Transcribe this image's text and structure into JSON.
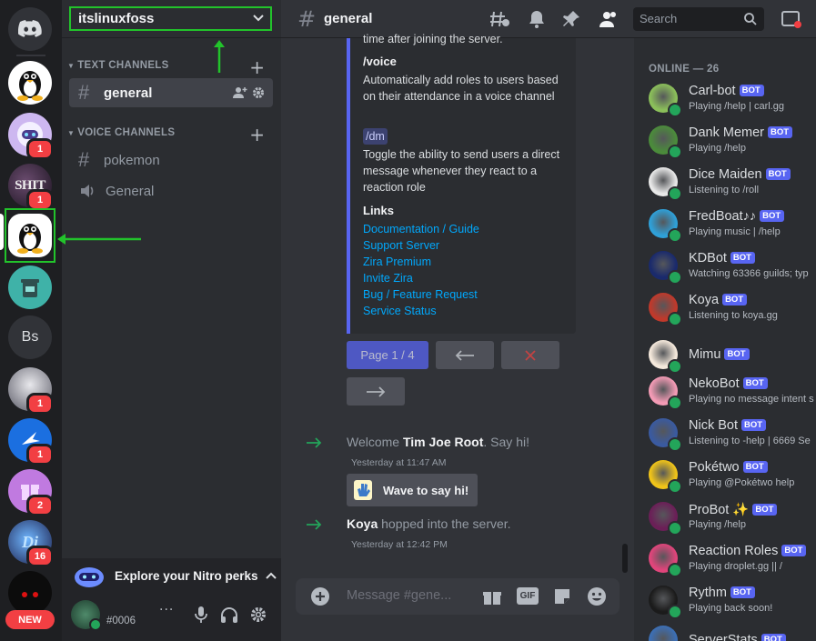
{
  "server": {
    "name": "itslinuxfoss"
  },
  "rail": {
    "servers": [
      {
        "label": "",
        "badge": ""
      },
      {
        "label": "",
        "badge": "1"
      },
      {
        "label": "SHIT",
        "badge": "1"
      },
      {
        "label": "",
        "badge": ""
      },
      {
        "label": "",
        "badge": ""
      },
      {
        "label": "Bs",
        "badge": ""
      },
      {
        "label": "",
        "badge": "1"
      },
      {
        "label": "",
        "badge": "1"
      },
      {
        "label": "",
        "badge": "2"
      },
      {
        "label": "",
        "badge": "16"
      },
      {
        "label": "",
        "badge": ""
      }
    ],
    "new_label": "NEW"
  },
  "sidebar": {
    "text_category": "TEXT CHANNELS",
    "voice_category": "VOICE CHANNELS",
    "text_channels": [
      {
        "name": "general"
      }
    ],
    "voice_channels": [
      {
        "name": "pokemon",
        "icon": "hash"
      },
      {
        "name": "General",
        "icon": "speaker"
      }
    ],
    "nitro": "Explore your Nitro perks",
    "user_tag": "#0006"
  },
  "topbar": {
    "channel": "general",
    "search_placeholder": "Search"
  },
  "embed": {
    "cut_line": "time after joining the server.",
    "voice_cmd": "/voice",
    "voice_desc": "Automatically add roles to users based on their attendance in a voice channel",
    "dm_cmd": "/dm",
    "dm_desc": "Toggle the ability to send users a direct message whenever they react to a reaction role",
    "links_title": "Links",
    "links": [
      "Documentation / Guide",
      "Support Server",
      "Zira Premium",
      "Invite Zira",
      "Bug / Feature Request",
      "Service Status"
    ]
  },
  "pager": {
    "page": "Page 1 / 4"
  },
  "messages": [
    {
      "pre": "Welcome ",
      "name": "Tim Joe Root",
      "post": ". Say hi!",
      "time": "Yesterday at 11:47 AM",
      "wave": "Wave to say hi!"
    },
    {
      "pre": "",
      "name": "Koya",
      "post": " hopped into the server.",
      "time": "Yesterday at 12:42 PM"
    }
  ],
  "composer": {
    "placeholder": "Message #gene..."
  },
  "members": {
    "header": "ONLINE — 26",
    "bot_label": "BOT",
    "list": [
      {
        "name": "Carl-bot",
        "activity": "Playing /help | carl.gg",
        "color": "#8bbf5a"
      },
      {
        "name": "Dank Memer",
        "activity": "Playing /help",
        "color": "#4b8b3b"
      },
      {
        "name": "Dice Maiden",
        "activity": "Listening to /roll",
        "color": "#e8e8e8"
      },
      {
        "name": "FredBoat♪♪",
        "activity": "Playing music | /help",
        "color": "#2fa0d8"
      },
      {
        "name": "KDBot",
        "activity": "Watching 63366 guilds; typ",
        "color": "#1a2a6c"
      },
      {
        "name": "Koya",
        "activity": "Listening to koya.gg",
        "color": "#c0392b"
      },
      {
        "name": "Mimu",
        "activity": "",
        "color": "#f5e9dc"
      },
      {
        "name": "NekoBot",
        "activity": "Playing no message intent s",
        "color": "#f39bb5"
      },
      {
        "name": "Nick Bot",
        "activity": "Listening to -help | 6669 Se",
        "color": "#3a5aa0"
      },
      {
        "name": "Pokétwo",
        "activity": "Playing @Pokétwo help",
        "color": "#f0c419"
      },
      {
        "name": "ProBot ✨",
        "activity": "Playing /help",
        "color": "#6b1f57"
      },
      {
        "name": "Reaction Roles",
        "activity": "Playing droplet.gg || /",
        "color": "#e0457b"
      },
      {
        "name": "Rythm",
        "activity": "Playing back soon!",
        "color": "#1b1b1b"
      },
      {
        "name": "ServerStats",
        "activity": "",
        "color": "#3c6fb5"
      }
    ]
  },
  "colors": {
    "accent": "#5865f2",
    "highlight": "#22c32b",
    "online": "#23a55a",
    "badge": "#f23f43"
  }
}
